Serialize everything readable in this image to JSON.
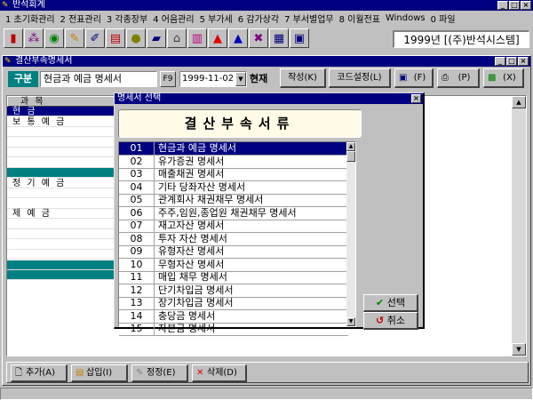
{
  "app": {
    "title": "반석회계"
  },
  "menu": [
    "1 초기화관리",
    "2 전표관리",
    "3 각종장부",
    "4 어음관리",
    "5 부가세",
    "6 감가상각",
    "7 부서별업무",
    "8 이월전표",
    "Windows",
    "0 파일"
  ],
  "toolbar": {
    "company": "1999년 [(주)반석시스템]"
  },
  "window": {
    "title": "결산부속명세서"
  },
  "form": {
    "gubun_label": "구분",
    "document_value": "현금과 예금 명세서",
    "f9_label": "F9",
    "date_value": "1999-11-02",
    "current_label": "현재",
    "buttons": [
      "작성(K)",
      "코드설정(L)",
      "(F)",
      "(P)",
      "(X)"
    ]
  },
  "grid": {
    "header": "과 목",
    "rows": [
      {
        "text": "현 금",
        "style": "sel"
      },
      {
        "text": "보 통 예 금",
        "style": ""
      },
      {
        "text": "",
        "style": ""
      },
      {
        "text": "",
        "style": ""
      },
      {
        "text": "",
        "style": ""
      },
      {
        "text": "",
        "style": ""
      },
      {
        "text": "",
        "style": "teal"
      },
      {
        "text": "정 기 예 금",
        "style": ""
      },
      {
        "text": "",
        "style": ""
      },
      {
        "text": "",
        "style": ""
      },
      {
        "text": "제 예 금",
        "style": ""
      },
      {
        "text": "",
        "style": ""
      },
      {
        "text": "",
        "style": ""
      },
      {
        "text": "",
        "style": ""
      },
      {
        "text": "",
        "style": ""
      },
      {
        "text": "",
        "style": "teal"
      },
      {
        "text": "",
        "style": "teal"
      }
    ]
  },
  "bottom_buttons": [
    "추가(A)",
    "삽입(I)",
    "정정(E)",
    "삭제(D)"
  ],
  "dialog": {
    "title": "명세서 선택",
    "header": "결산부속서류",
    "items": [
      {
        "num": "01",
        "name": "현금과 예금 명세서"
      },
      {
        "num": "02",
        "name": "유가증권 명세서"
      },
      {
        "num": "03",
        "name": "매출채권 명세서"
      },
      {
        "num": "04",
        "name": "기타 당좌자산 명세서"
      },
      {
        "num": "05",
        "name": "관계회사 채권채무 명세서"
      },
      {
        "num": "06",
        "name": "주주,임원,종업원 채권채무 명세서"
      },
      {
        "num": "07",
        "name": "재고자산 명세서"
      },
      {
        "num": "08",
        "name": "투자 자산 명세서"
      },
      {
        "num": "09",
        "name": "유형자산 명세서"
      },
      {
        "num": "10",
        "name": "무형자산 명세서"
      },
      {
        "num": "11",
        "name": "매입 채무 명세서"
      },
      {
        "num": "12",
        "name": "단기차입금 명세서"
      },
      {
        "num": "13",
        "name": "장기차입금 명세서"
      },
      {
        "num": "14",
        "name": "충당금 명세서"
      },
      {
        "num": "15",
        "name": "자본금 명세서"
      }
    ],
    "select_button": "선택",
    "cancel_button": "취소"
  }
}
